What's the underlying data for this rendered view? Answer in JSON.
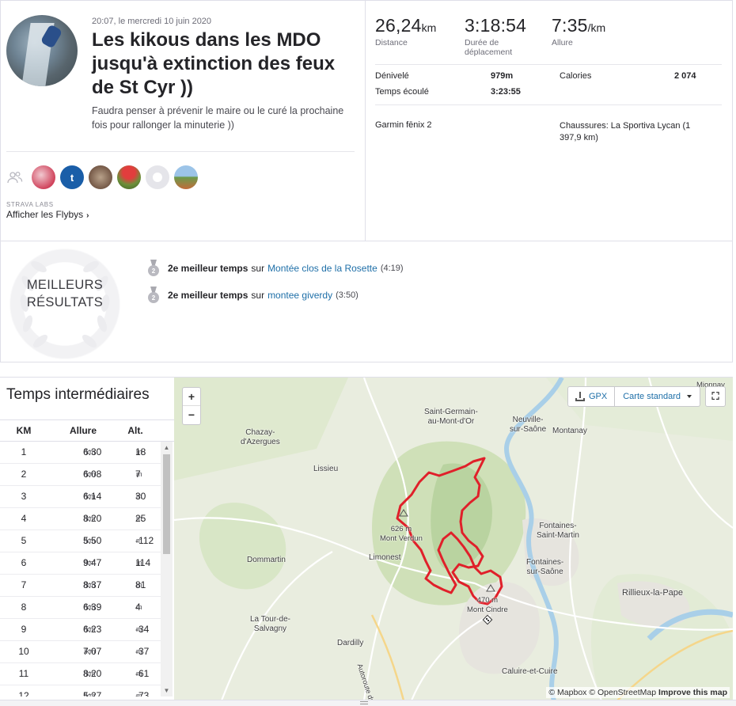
{
  "activity": {
    "date": "20:07, le mercredi 10 juin 2020",
    "title": "Les kikous dans les MDO jusqu'à extinction des feux de St Cyr ))",
    "description": "Faudra penser à prévenir le maire ou le curé la prochaine fois pour rallonger la minuterie ))"
  },
  "kudos": {
    "avatars": [
      {
        "letter": "",
        "color": "#d0435c"
      },
      {
        "letter": "t",
        "color": "#1a5ea8"
      },
      {
        "letter": "",
        "color": "#6b4e3d"
      },
      {
        "letter": "",
        "color": "#6c8f3a"
      },
      {
        "letter": "",
        "color": "#e5e5ea"
      },
      {
        "letter": "",
        "color": "#9cc4e8"
      }
    ]
  },
  "labs": {
    "label": "STRAVA LABS",
    "flyby": "Afficher les Flybys",
    "chevron": "›"
  },
  "stats": {
    "distance": {
      "value": "26,24",
      "unit": "km",
      "label": "Distance"
    },
    "moving_time": {
      "value": "3:18:54",
      "label": "Durée de déplacement"
    },
    "pace": {
      "value": "7:35",
      "unit": "/km",
      "label": "Allure"
    },
    "elevation": {
      "label": "Dénivelé",
      "value": "979m"
    },
    "elapsed": {
      "label": "Temps écoulé",
      "value": "3:23:55"
    },
    "calories": {
      "label": "Calories",
      "value": "2 074"
    },
    "device": "Garmin fēnix 2",
    "shoes": "Chaussures: La Sportiva Lycan (1 397,9 km)"
  },
  "best_efforts": {
    "heading_1": "MEILLEURS",
    "heading_2": "RÉSULTATS",
    "items": [
      {
        "rank": "2",
        "label": "2e meilleur temps",
        "connector": "sur",
        "segment": "Montée clos de la Rosette",
        "time": "(4:19)"
      },
      {
        "rank": "2",
        "label": "2e meilleur temps",
        "connector": "sur",
        "segment": "montee giverdy",
        "time": "(3:50)"
      }
    ]
  },
  "splits": {
    "title": "Temps intermédiaires",
    "headers": {
      "km": "KM",
      "pace": "Allure",
      "alt": "Alt."
    },
    "pace_unit": "/km",
    "alt_unit": "m",
    "rows": [
      {
        "km": "1",
        "pace": "6:30",
        "alt": "18"
      },
      {
        "km": "2",
        "pace": "6:08",
        "alt": "7"
      },
      {
        "km": "3",
        "pace": "6:14",
        "alt": "30"
      },
      {
        "km": "4",
        "pace": "8:20",
        "alt": "25"
      },
      {
        "km": "5",
        "pace": "5:50",
        "alt": "-112"
      },
      {
        "km": "6",
        "pace": "9:47",
        "alt": "114"
      },
      {
        "km": "7",
        "pace": "8:37",
        "alt": "81"
      },
      {
        "km": "8",
        "pace": "6:39",
        "alt": "4"
      },
      {
        "km": "9",
        "pace": "6:23",
        "alt": "-34"
      },
      {
        "km": "10",
        "pace": "7:07",
        "alt": "-37"
      },
      {
        "km": "11",
        "pace": "8:20",
        "alt": "-61"
      },
      {
        "km": "12",
        "pace": "5:27",
        "alt": "-73"
      }
    ]
  },
  "map": {
    "zoom_in": "+",
    "zoom_out": "−",
    "gpx": "GPX",
    "style": "Carte standard",
    "fullscreen": "⛶",
    "attribution_1": "© Mapbox © OpenStreetMap",
    "attribution_2": "Improve this map",
    "route_color": "#e0202a",
    "places": {
      "mionnay": "Mionnay",
      "saint_germain": "Saint-Germain-\nau-Mont-d'Or",
      "neuville": "Neuville-\nsur-Saône",
      "montanay": "Montanay",
      "chazay": "Chazay-\nd'Azergues",
      "lissieu": "Lissieu",
      "fontaines_st_martin": "Fontaines-\nSaint-Martin",
      "fontaines_sur_saone": "Fontaines-\nsur-Saône",
      "dommartin": "Dommartin",
      "limonest": "Limonest",
      "rillieux": "Rillieux-la-Pape",
      "tour_salvagny": "La Tour-de-\nSalvagny",
      "dardilly": "Dardilly",
      "caluire": "Caluire-et-Cuire",
      "autoroute": "Autoroute du Soleil",
      "peak1": "626 m\nMont Verdun",
      "peak2": "470 m\nMont Cindre"
    }
  }
}
